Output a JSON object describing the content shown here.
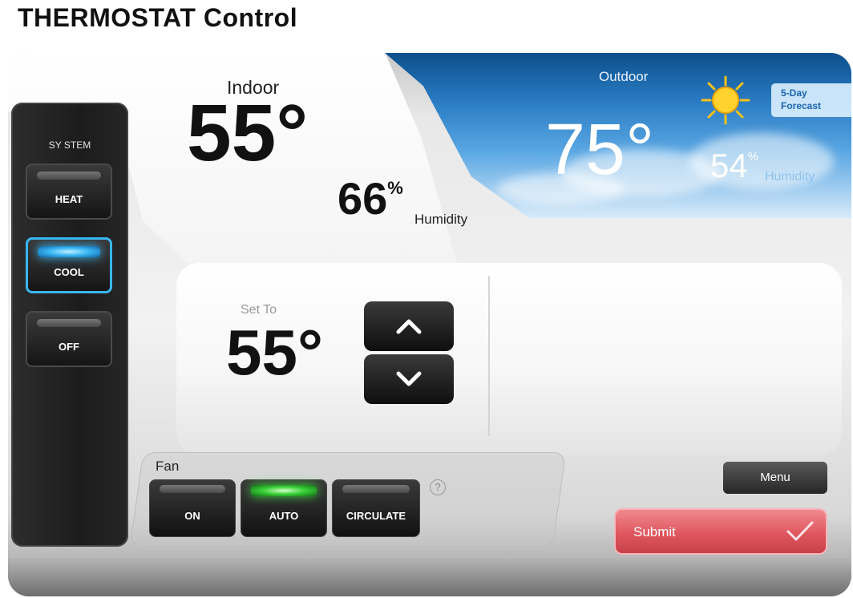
{
  "page": {
    "title": "THERMOSTAT Control"
  },
  "system": {
    "label": "SY STEM",
    "modes": [
      {
        "label": "HEAT",
        "active": false
      },
      {
        "label": "COOL",
        "active": true
      },
      {
        "label": "OFF",
        "active": false
      }
    ]
  },
  "indoor": {
    "label": "Indoor",
    "temperature": "55°",
    "humidity": "66",
    "humidity_unit": "%",
    "humidity_label": "Humidity"
  },
  "outdoor": {
    "label": "Outdoor",
    "temperature": "75°",
    "humidity": "54",
    "humidity_unit": "%",
    "humidity_label": "Humidity",
    "weather_icon": "sun-icon",
    "forecast_line1": "5-Day",
    "forecast_line2": "Forecast"
  },
  "setpoint": {
    "label": "Set To",
    "temperature": "55°"
  },
  "fan": {
    "label": "Fan",
    "modes": [
      {
        "label": "ON",
        "active": false
      },
      {
        "label": "AUTO",
        "active": true
      },
      {
        "label": "CIRCULATE",
        "active": false
      }
    ],
    "help": "?"
  },
  "actions": {
    "menu": "Menu",
    "submit": "Submit"
  },
  "colors": {
    "cool_accent": "#39b6ef",
    "fan_active": "#3bd23b",
    "submit": "#e0575f"
  }
}
